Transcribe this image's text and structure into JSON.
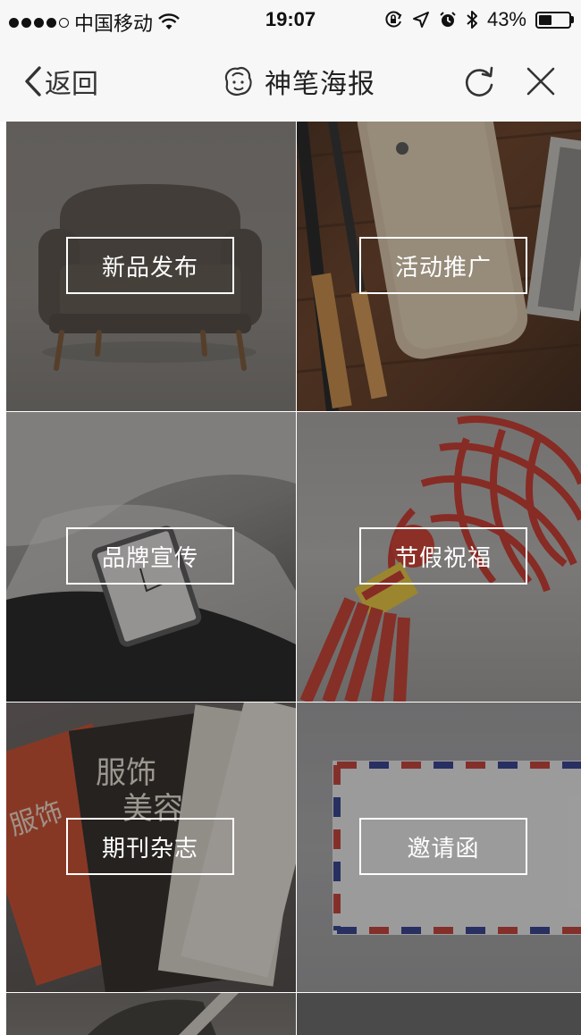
{
  "status_bar": {
    "carrier": "中国移动",
    "time": "19:07",
    "battery_percent": "43%",
    "battery_level": 0.43,
    "icons": [
      "signal-dots-icon",
      "wifi-icon",
      "orientation-lock-icon",
      "location-icon",
      "alarm-icon",
      "bluetooth-icon",
      "battery-icon"
    ]
  },
  "nav": {
    "back_label": "返回",
    "title": "神笔海报",
    "icons": {
      "back": "chevron-left-icon",
      "logo": "brush-face-logo-icon",
      "refresh": "refresh-icon",
      "close": "close-icon"
    }
  },
  "categories": [
    {
      "label": "新品发布",
      "image": "armchair-photo"
    },
    {
      "label": "活动推广",
      "image": "desk-phone-pens-photo"
    },
    {
      "label": "品牌宣传",
      "image": "wristwatch-photo"
    },
    {
      "label": "节假祝福",
      "image": "chinese-knot-photo"
    },
    {
      "label": "期刊杂志",
      "image": "magazines-photo"
    },
    {
      "label": "邀请函",
      "image": "airmail-envelope-photo"
    }
  ],
  "magazine_text": {
    "title1": "服饰",
    "title2": "美容"
  },
  "colors": {
    "nav_bg": "#f7f7f7",
    "label_text": "#ffffff",
    "overlay": "rgba(30,30,30,0.38)"
  }
}
